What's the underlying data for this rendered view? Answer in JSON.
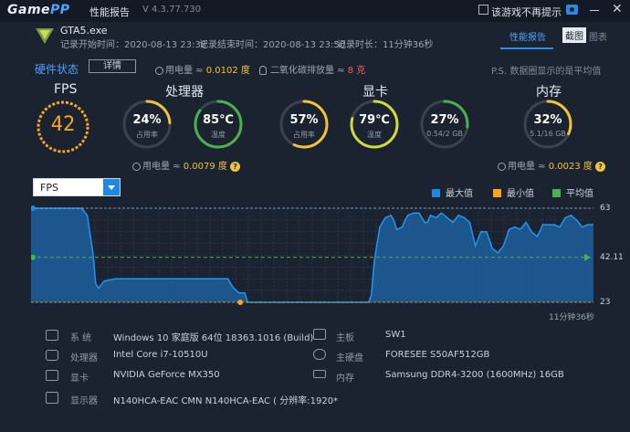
{
  "app": {
    "logo_main": "Game",
    "logo_accent": "PP",
    "window_title": "性能报告",
    "version": "V 4.3.77.730",
    "dont_show_label": "该游戏不再提示"
  },
  "game": {
    "name": "GTA5.exe",
    "start_time": "记录开始时间：2020-08-13 23:38",
    "end_time": "记录结束时间：2020-08-13 23:50",
    "duration": "记录时长：11分钟36秒"
  },
  "tabs": {
    "performance": "性能报告",
    "screenshot": "截图",
    "chart": "图表"
  },
  "hardware": {
    "title": "硬件状态",
    "detail_button": "详情",
    "power_label": "用电量 ≈",
    "power_value": "0.0102 度",
    "co2_label": "二氧化碳排放量 ≈",
    "co2_value": "8 克",
    "note": "P.S. 数据圈显示的是平均值"
  },
  "fps": {
    "title": "FPS",
    "value": "42"
  },
  "cpu": {
    "title": "处理器",
    "usage_value": "24%",
    "usage_label": "占用率",
    "usage_fraction": 0.24,
    "temp_value": "85℃",
    "temp_label": "温度",
    "temp_fraction": 0.85,
    "power_label": "用电量 ≈",
    "power_value": "0.0079 度"
  },
  "gpu": {
    "title": "显卡",
    "usage_value": "57%",
    "usage_label": "占用率",
    "usage_fraction": 0.57,
    "temp_value": "79℃",
    "temp_label": "温度",
    "temp_fraction": 0.79,
    "mem_value": "27%",
    "mem_label": "0.54/2 GB",
    "mem_fraction": 0.27
  },
  "ram": {
    "title": "内存",
    "usage_value": "32%",
    "usage_label": "5.1/16 GB",
    "usage_fraction": 0.32,
    "power_label": "用电量 ≈",
    "power_value": "0.0023 度"
  },
  "chart_controls": {
    "select_value": "FPS",
    "legend_max": "最大值",
    "legend_min": "最小值",
    "legend_avg": "平均值",
    "colors": {
      "max": "#1e88e5",
      "min": "#f5a623",
      "avg": "#4caf50",
      "line": "#2196f3",
      "fill": "#1d5f9c"
    }
  },
  "chart_data": {
    "type": "area",
    "ylim": [
      23,
      63
    ],
    "max_label": "63",
    "min_label": "23",
    "avg_label": "42.11",
    "avg": 42.11,
    "duration_label": "11分钟36秒",
    "x": [
      0,
      0.02,
      0.04,
      0.06,
      0.08,
      0.09,
      0.1,
      0.105,
      0.11,
      0.115,
      0.12,
      0.13,
      0.15,
      0.18,
      0.22,
      0.26,
      0.3,
      0.33,
      0.35,
      0.36,
      0.37,
      0.38,
      0.385,
      0.39,
      0.4,
      0.42,
      0.45,
      0.5,
      0.55,
      0.58,
      0.6,
      0.6,
      0.605,
      0.61,
      0.62,
      0.63,
      0.64,
      0.645,
      0.65,
      0.66,
      0.665,
      0.67,
      0.68,
      0.69,
      0.7,
      0.705,
      0.71,
      0.72,
      0.73,
      0.74,
      0.75,
      0.76,
      0.77,
      0.78,
      0.79,
      0.8,
      0.81,
      0.82,
      0.83,
      0.84,
      0.85,
      0.86,
      0.87,
      0.88,
      0.89,
      0.9,
      0.91,
      0.92,
      0.93,
      0.94,
      0.95,
      0.96,
      0.97,
      0.98,
      0.99,
      1.0
    ],
    "values": [
      63,
      63,
      63,
      63,
      63,
      63,
      60,
      52,
      44,
      31,
      29,
      32,
      33,
      33,
      33,
      33,
      33,
      33,
      33,
      29,
      27,
      27,
      23,
      23,
      23,
      23,
      23,
      23,
      23,
      23,
      23,
      23,
      26,
      40,
      55,
      59,
      60,
      58,
      54,
      55,
      58,
      60,
      61,
      61,
      57,
      57,
      60,
      59,
      61,
      59,
      57,
      60,
      59,
      57,
      47,
      53,
      53,
      46,
      44,
      47,
      54,
      55,
      54,
      57,
      53,
      51,
      56,
      56,
      56,
      55,
      59,
      60,
      58,
      55,
      56,
      56
    ]
  },
  "system": {
    "os_label": "系  统",
    "os_value": "Windows 10 家庭版 64位   18363.1016 (Build)",
    "cpu_label": "处理器",
    "cpu_value": "Intel Core i7-10510U",
    "gpu_label": "显卡",
    "gpu_value": "NVIDIA GeForce MX350",
    "monitor_label": "显示器",
    "monitor_value": "N140HCA-EAC CMN N140HCA-EAC ( 分辨率:1920*",
    "board_label": "主板",
    "board_value": "SW1",
    "disk_label": "主硬盘",
    "disk_value": "FORESEE S50AF512GB",
    "mem_label": "内存",
    "mem_value": "Samsung DDR4-3200 (1600MHz) 16GB"
  }
}
